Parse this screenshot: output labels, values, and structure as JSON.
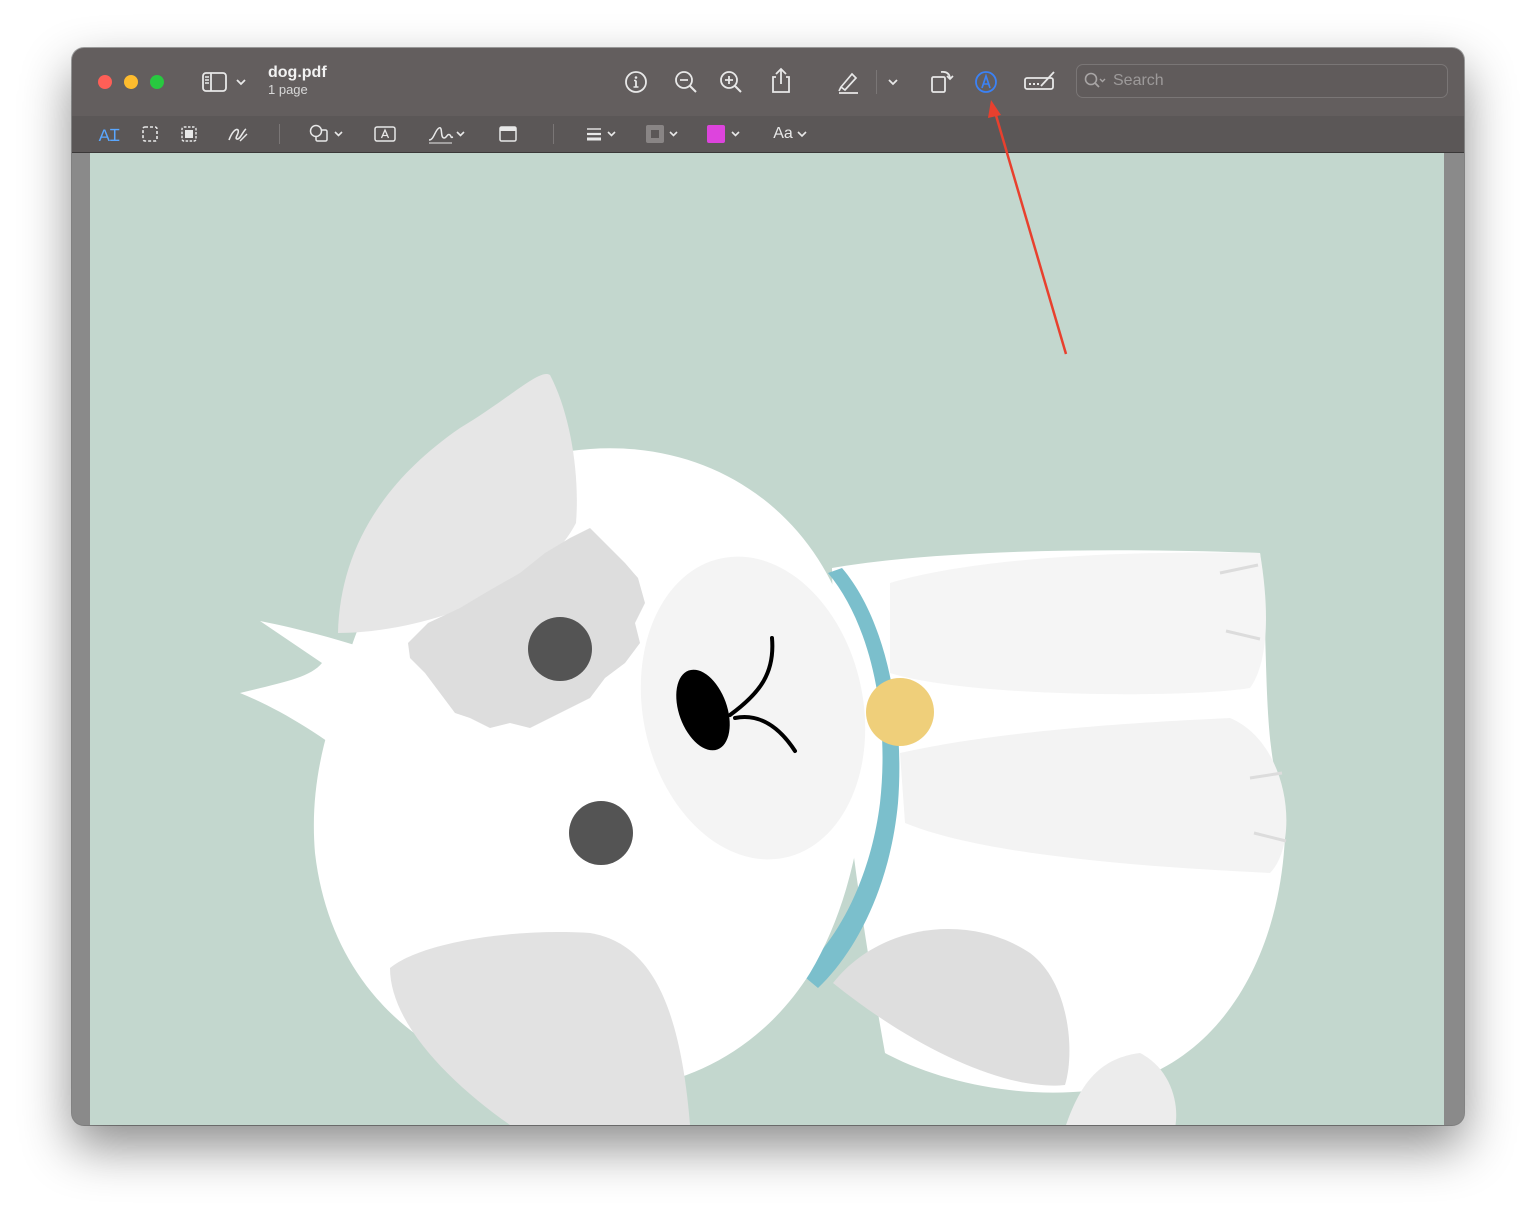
{
  "window": {
    "document_name": "dog.pdf",
    "page_count_label": "1 page"
  },
  "search": {
    "placeholder": "Search"
  },
  "markup_toolbar": {
    "text_tool_label": "A",
    "font_button_label": "Aa"
  },
  "colors": {
    "page_background": "#c3d7ce",
    "markup_active": "#3b82f6",
    "fill_color_swatch": "#dd44dd",
    "annotation_arrow": "#e8402e",
    "dog_collar": "#7bbfcc",
    "dog_tag": "#efcf7a"
  },
  "icons": [
    "sidebar-icon",
    "info-icon",
    "zoom-out-icon",
    "zoom-in-icon",
    "share-icon",
    "highlight-icon",
    "rotate-icon",
    "markup-icon",
    "form-fill-icon",
    "search-icon",
    "text-selection-icon",
    "rect-selection-icon",
    "smart-lasso-icon",
    "sketch-icon",
    "shapes-icon",
    "textbox-icon",
    "signature-icon",
    "note-icon",
    "line-style-icon",
    "border-color-icon",
    "fill-color-icon",
    "text-style-icon"
  ]
}
